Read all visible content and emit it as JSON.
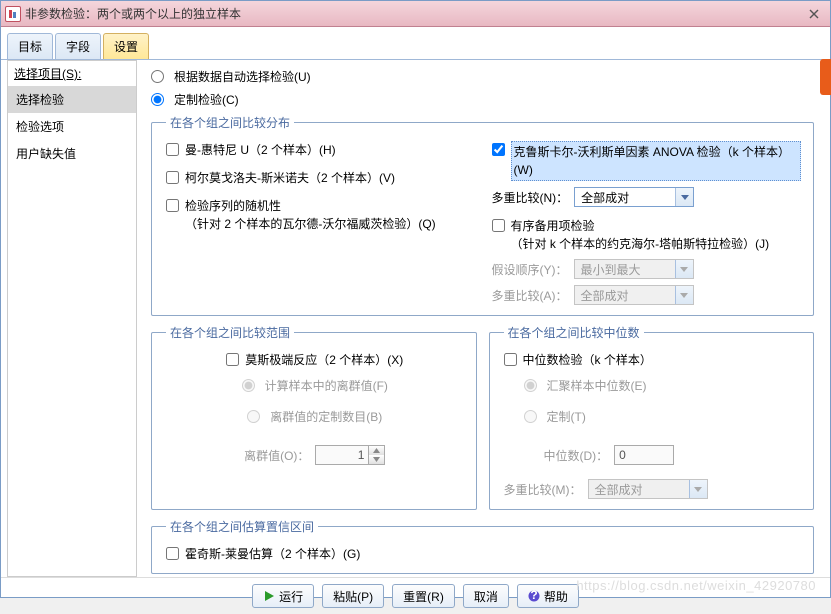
{
  "window": {
    "title": "非参数检验：两个或两个以上的独立样本"
  },
  "tabs": [
    "目标",
    "字段",
    "设置"
  ],
  "activeTab": 2,
  "sidebar": {
    "title": "选择项目(S):",
    "items": [
      "选择检验",
      "检验选项",
      "用户缺失值"
    ],
    "activeIndex": 0
  },
  "radios": {
    "auto": "根据数据自动选择检验(U)",
    "custom": "定制检验(C)",
    "selected": "custom"
  },
  "group_dist": {
    "legend": "在各个组之间比较分布",
    "mann": "曼-惠特尼 U（2 个样本）(H)",
    "ks": "柯尔莫戈洛夫-斯米诺夫（2 个样本）(V)",
    "runs_title": "检验序列的随机性",
    "runs_sub": "（针对 2 个样本的瓦尔德-沃尔福威茨检验）(Q)",
    "kruskal": "克鲁斯卡尔-沃利斯单因素 ANOVA 检验（k 个样本）(W)",
    "multi_label": "多重比较(N)：",
    "multi_value": "全部成对",
    "jt_title": "有序备用项检验",
    "jt_sub": "（针对 k 个样本的约克海尔-塔帕斯特拉检验）(J)",
    "order_label": "假设顺序(Y)：",
    "order_value": "最小到最大",
    "multiA_label": "多重比较(A)：",
    "multiA_value": "全部成对"
  },
  "group_range": {
    "legend": "在各个组之间比较范围",
    "moses": "莫斯极端反应（2 个样本）(X)",
    "calc_outlier": "计算样本中的离群值(F)",
    "custom_outlier": "离群值的定制数目(B)",
    "outlier_label": "离群值(O)：",
    "outlier_value": "1"
  },
  "group_median": {
    "legend": "在各个组之间比较中位数",
    "median_test": "中位数检验（k 个样本）",
    "pool": "汇聚样本中位数(E)",
    "custom": "定制(T)",
    "median_label": "中位数(D)：",
    "median_value": "0",
    "multiM_label": "多重比较(M)：",
    "multiM_value": "全部成对"
  },
  "group_ci": {
    "legend": "在各个组之间估算置信区间",
    "hodges": "霍奇斯-莱曼估算（2 个样本）(G)"
  },
  "buttons": {
    "run": "运行",
    "paste": "粘贴(P)",
    "reset": "重置(R)",
    "cancel": "取消",
    "help": "帮助"
  },
  "watermark": "https://blog.csdn.net/weixin_42920780"
}
